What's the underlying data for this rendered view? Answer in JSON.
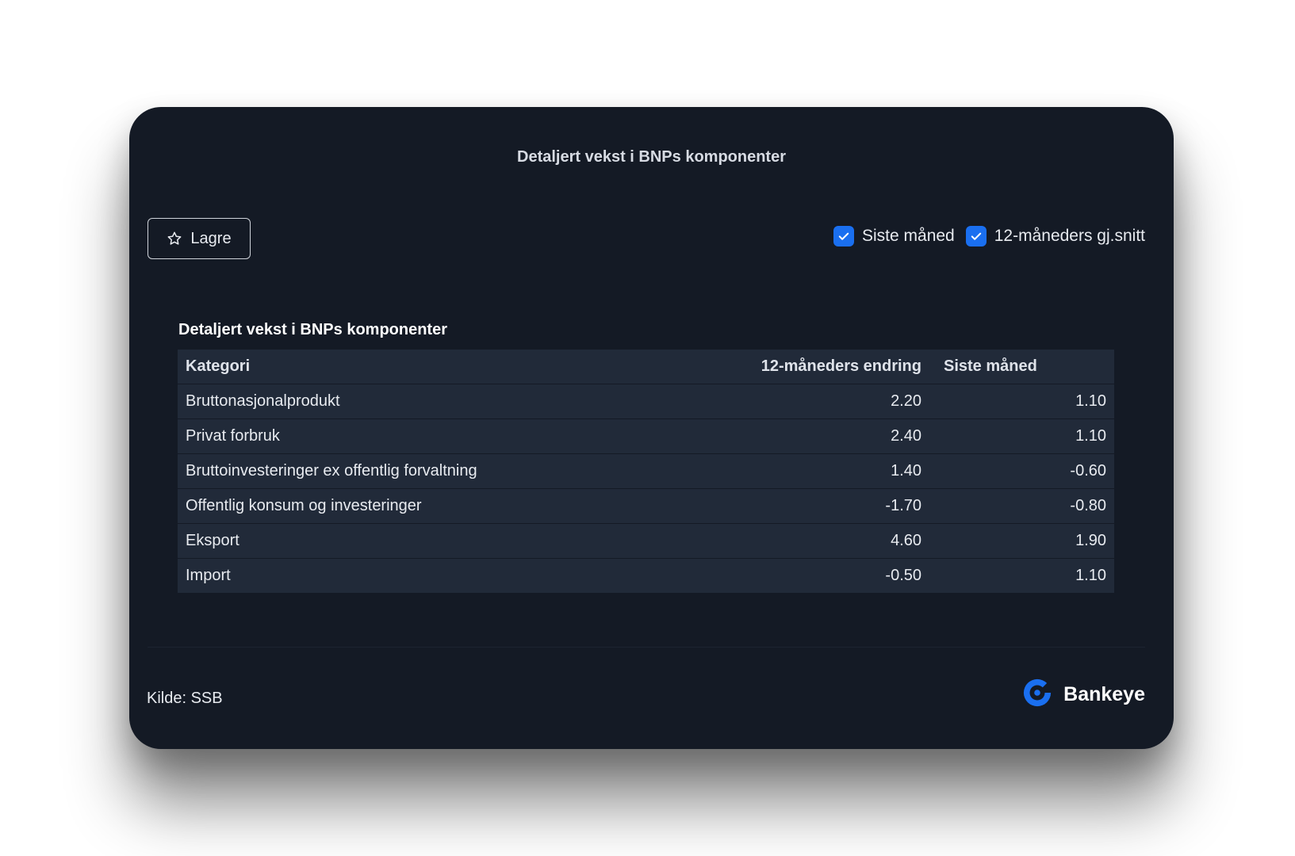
{
  "card": {
    "title": "Detaljert vekst i BNPs komponenter"
  },
  "toolbar": {
    "save_label": "Lagre",
    "save_icon": "star-outline-icon",
    "toggles": [
      {
        "label": "Siste måned",
        "checked": true
      },
      {
        "label": "12-måneders gj.snitt",
        "checked": true
      }
    ]
  },
  "table": {
    "title": "Detaljert vekst i BNPs komponenter",
    "headers": [
      "Kategori",
      "12-måneders endring",
      "Siste måned"
    ],
    "rows": [
      {
        "kategori": "Bruttonasjonalprodukt",
        "endring_12m": "2.20",
        "siste_maaned": "1.10"
      },
      {
        "kategori": "Privat forbruk",
        "endring_12m": "2.40",
        "siste_maaned": "1.10"
      },
      {
        "kategori": "Bruttoinvesteringer ex offentlig forvaltning",
        "endring_12m": "1.40",
        "siste_maaned": "-0.60"
      },
      {
        "kategori": "Offentlig konsum og investeringer",
        "endring_12m": "-1.70",
        "siste_maaned": "-0.80"
      },
      {
        "kategori": "Eksport",
        "endring_12m": "4.60",
        "siste_maaned": "1.90"
      },
      {
        "kategori": "Import",
        "endring_12m": "-0.50",
        "siste_maaned": "1.10"
      }
    ]
  },
  "footer": {
    "source": "Kilde: SSB",
    "brand": "Bankeye"
  },
  "colors": {
    "card_bg": "#141a25",
    "table_bg": "#212a39",
    "accent": "#1a6ff0"
  }
}
